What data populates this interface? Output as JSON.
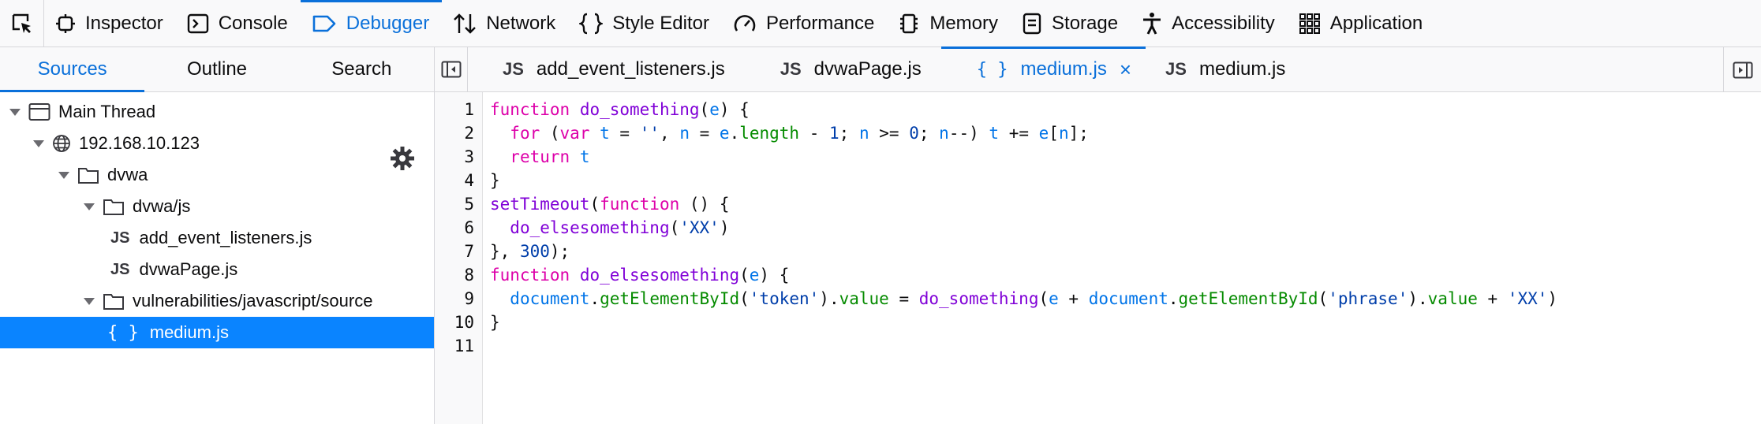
{
  "toolbar": {
    "tabs": [
      {
        "label": "Inspector"
      },
      {
        "label": "Console"
      },
      {
        "label": "Debugger"
      },
      {
        "label": "Network"
      },
      {
        "label": "Style Editor"
      },
      {
        "label": "Performance"
      },
      {
        "label": "Memory"
      },
      {
        "label": "Storage"
      },
      {
        "label": "Accessibility"
      },
      {
        "label": "Application"
      }
    ],
    "active": "Debugger"
  },
  "sources_panel": {
    "tabs": [
      {
        "label": "Sources"
      },
      {
        "label": "Outline"
      },
      {
        "label": "Search"
      }
    ],
    "tree": [
      {
        "label": "Main Thread"
      },
      {
        "label": "192.168.10.123"
      },
      {
        "label": "dvwa"
      },
      {
        "label": "dvwa/js"
      },
      {
        "label": "add_event_listeners.js",
        "badge": "JS"
      },
      {
        "label": "dvwaPage.js",
        "badge": "JS"
      },
      {
        "label": "vulnerabilities/javascript/source"
      },
      {
        "label": "medium.js",
        "badge": "{ }"
      }
    ]
  },
  "editor": {
    "tabs": [
      {
        "label": "add_event_listeners.js",
        "badge": "JS"
      },
      {
        "label": "dvwaPage.js",
        "badge": "JS"
      },
      {
        "label": "medium.js",
        "badge": "{ }",
        "close": "×"
      },
      {
        "label": "medium.js",
        "badge": "JS"
      }
    ],
    "line_numbers": [
      "1",
      "2",
      "3",
      "4",
      "5",
      "6",
      "7",
      "8",
      "9",
      "10",
      "11"
    ],
    "code_lines": [
      "function do_something(e) {",
      "  for (var t = '', n = e.length - 1; n >= 0; n--) t += e[n];",
      "  return t",
      "}",
      "setTimeout(function () {",
      "  do_elsesomething('XX')",
      "}, 300);",
      "function do_elsesomething(e) {",
      "  document.getElementById('token').value = do_something(e + document.getElementById('phrase').value + 'XX')",
      "}",
      ""
    ]
  },
  "colors": {
    "accent": "#0a70da",
    "selection": "#0a84ff",
    "keyword": "#dd00a9",
    "function": "#8000d7",
    "variable": "#0074e8",
    "property": "#058b00",
    "string": "#003eaa"
  }
}
